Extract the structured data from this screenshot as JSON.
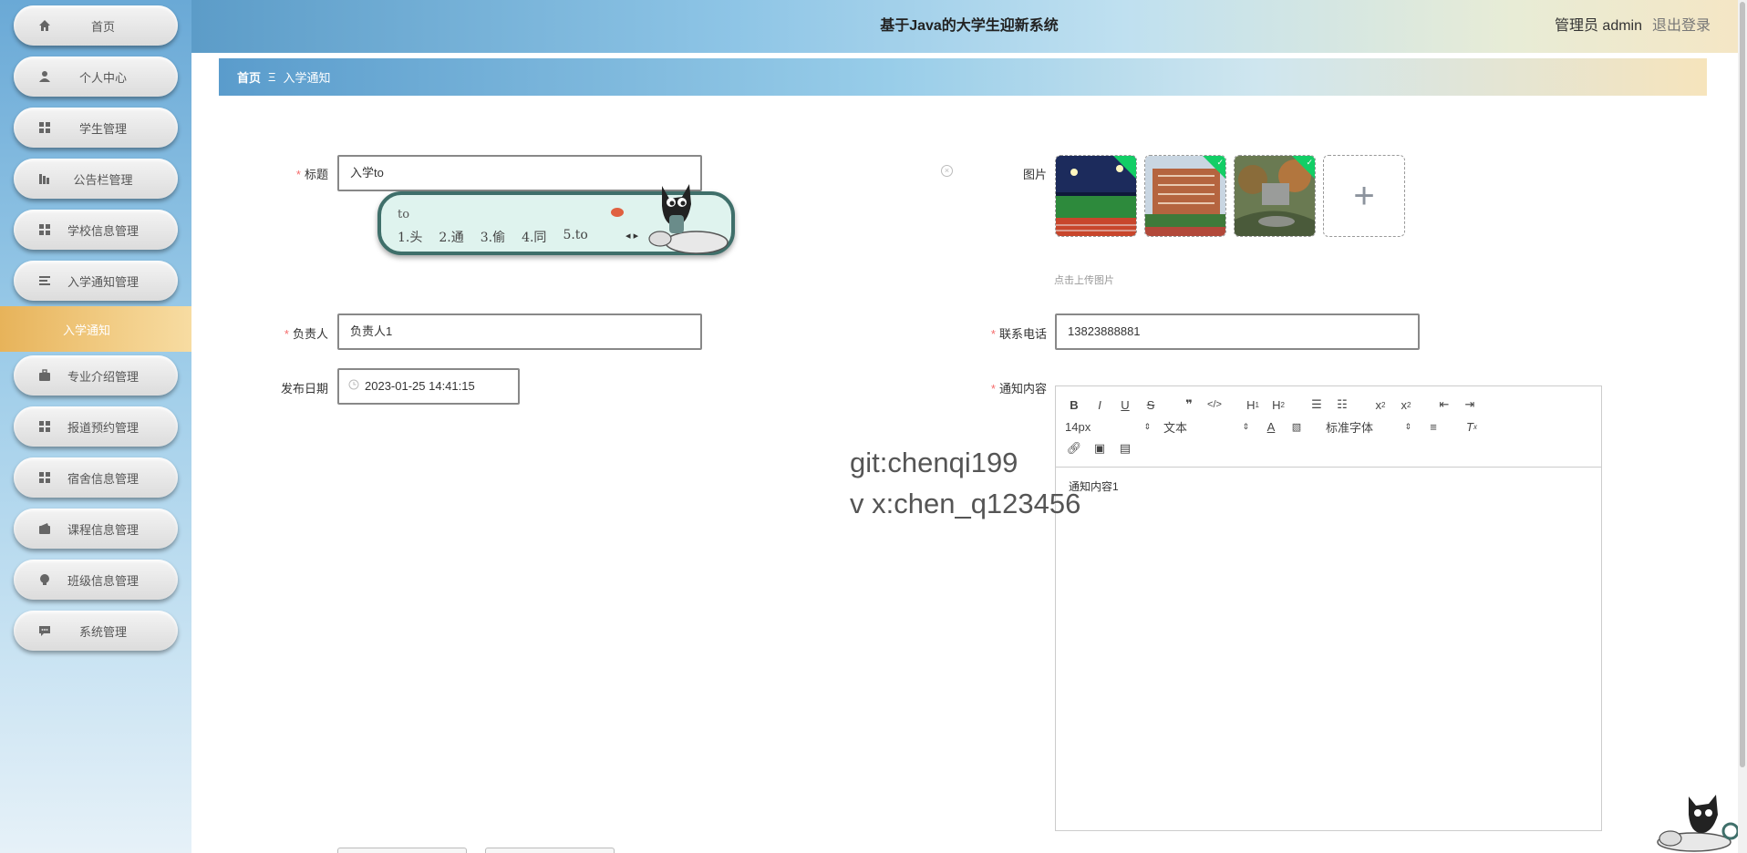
{
  "header": {
    "title": "基于Java的大学生迎新系统",
    "user": "管理员 admin",
    "logout": "退出登录"
  },
  "sidebar": {
    "items": [
      {
        "label": "首页",
        "icon": "home-icon"
      },
      {
        "label": "个人中心",
        "icon": "user-icon"
      },
      {
        "label": "学生管理",
        "icon": "grid-icon"
      },
      {
        "label": "公告栏管理",
        "icon": "bar-chart-icon"
      },
      {
        "label": "学校信息管理",
        "icon": "grid-icon"
      },
      {
        "label": "入学通知管理",
        "icon": "list-icon"
      },
      {
        "label": "专业介绍管理",
        "icon": "briefcase-icon"
      },
      {
        "label": "报道预约管理",
        "icon": "grid-icon"
      },
      {
        "label": "宿舍信息管理",
        "icon": "grid-icon"
      },
      {
        "label": "课程信息管理",
        "icon": "wallet-icon"
      },
      {
        "label": "班级信息管理",
        "icon": "bulb-icon"
      },
      {
        "label": "系统管理",
        "icon": "chat-icon"
      }
    ],
    "active_sub": "入学通知"
  },
  "breadcrumb": {
    "home": "首页",
    "separator": "Ξ",
    "current": "入学通知"
  },
  "form": {
    "title_label": "标题",
    "title_value": "入学to",
    "owner_label": "负责人",
    "owner_value": "负责人1",
    "date_label": "发布日期",
    "date_value": "2023-01-25 14:41:15",
    "image_label": "图片",
    "image_hint": "点击上传图片",
    "phone_label": "联系电话",
    "phone_value": "13823888881",
    "content_label": "通知内容",
    "content_value": "通知内容1"
  },
  "ime": {
    "typed": "to",
    "candidates": [
      "1.头",
      "2.通",
      "3.偷",
      "4.同",
      "5.to"
    ]
  },
  "editor": {
    "font_size": "14px",
    "block_type": "文本",
    "font_family": "标准字体"
  },
  "watermark": {
    "line1": "git:chenqi199",
    "line2": "v x:chen_q123456"
  },
  "colors": {
    "required": "#f56c6c",
    "active_sub": "#f2cd86",
    "success_corner": "#13ce66"
  }
}
